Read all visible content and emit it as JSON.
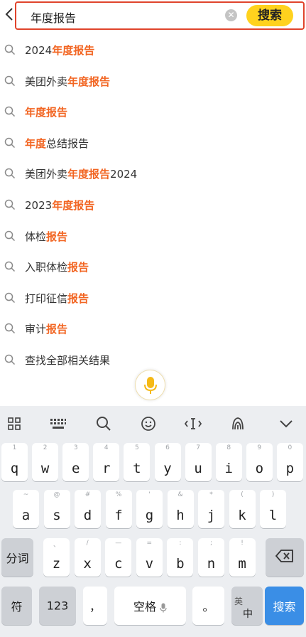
{
  "search": {
    "query": "年度报告",
    "button_label": "搜索"
  },
  "suggestions": [
    {
      "pre": "2024",
      "hl": "年度报告",
      "post": ""
    },
    {
      "pre": "美团外卖",
      "hl": "年度报告",
      "post": ""
    },
    {
      "pre": "",
      "hl": "年度报告",
      "post": ""
    },
    {
      "pre": "",
      "hl": "年度",
      "post": "总结报告"
    },
    {
      "pre": "美团外卖",
      "hl": "年度报告",
      "post": "2024"
    },
    {
      "pre": "2023",
      "hl": "年度报告",
      "post": ""
    },
    {
      "pre": "体检",
      "hl": "报告",
      "post": ""
    },
    {
      "pre": "入职体检",
      "hl": "报告",
      "post": ""
    },
    {
      "pre": "打印征信",
      "hl": "报告",
      "post": ""
    },
    {
      "pre": "审计",
      "hl": "报告",
      "post": ""
    },
    {
      "pre": "查找全部相关结果",
      "hl": "",
      "post": ""
    }
  ],
  "keyboard": {
    "row1": [
      {
        "k": "q",
        "s": "1"
      },
      {
        "k": "w",
        "s": "2"
      },
      {
        "k": "e",
        "s": "3"
      },
      {
        "k": "r",
        "s": "4"
      },
      {
        "k": "t",
        "s": "5"
      },
      {
        "k": "y",
        "s": "6"
      },
      {
        "k": "u",
        "s": "7"
      },
      {
        "k": "i",
        "s": "8"
      },
      {
        "k": "o",
        "s": "9"
      },
      {
        "k": "p",
        "s": "0"
      }
    ],
    "row2": [
      {
        "k": "a",
        "s": "~"
      },
      {
        "k": "s",
        "s": "@"
      },
      {
        "k": "d",
        "s": "#"
      },
      {
        "k": "f",
        "s": "%"
      },
      {
        "k": "g",
        "s": "'"
      },
      {
        "k": "h",
        "s": "&"
      },
      {
        "k": "j",
        "s": "*"
      },
      {
        "k": "k",
        "s": "("
      },
      {
        "k": "l",
        "s": ")"
      }
    ],
    "row3": [
      {
        "k": "z",
        "s": "、"
      },
      {
        "k": "x",
        "s": "/"
      },
      {
        "k": "c",
        "s": "—"
      },
      {
        "k": "v",
        "s": "="
      },
      {
        "k": "b",
        "s": ":"
      },
      {
        "k": "n",
        "s": ";"
      },
      {
        "k": "m",
        "s": "!"
      }
    ],
    "fenci": "分词",
    "fu": "符",
    "num": "123",
    "comma": "，",
    "space": "空格",
    "period": "。",
    "lang_top": "英",
    "lang_bottom": "中",
    "search": "搜索"
  },
  "colors": {
    "accent": "#f26522",
    "search_button": "#ffd21e",
    "search_border": "#e0442c",
    "key_blue": "#3a8ee6"
  }
}
